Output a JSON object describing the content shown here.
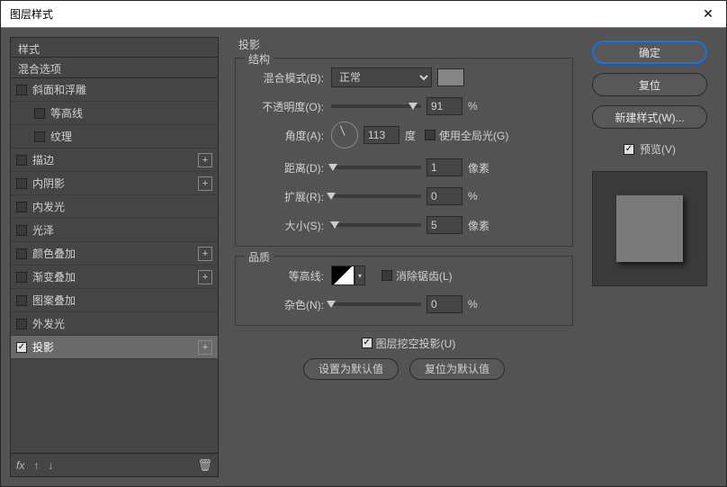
{
  "window": {
    "title": "图层样式"
  },
  "left": {
    "header": "样式",
    "blending": "混合选项",
    "items": [
      {
        "label": "斜面和浮雕",
        "checked": false,
        "plus": false
      },
      {
        "label": "等高线",
        "checked": false,
        "indent": true
      },
      {
        "label": "纹理",
        "checked": false,
        "indent": true
      },
      {
        "label": "描边",
        "checked": false,
        "plus": true
      },
      {
        "label": "内阴影",
        "checked": false,
        "plus": true
      },
      {
        "label": "内发光",
        "checked": false
      },
      {
        "label": "光泽",
        "checked": false
      },
      {
        "label": "颜色叠加",
        "checked": false,
        "plus": true
      },
      {
        "label": "渐变叠加",
        "checked": false,
        "plus": true
      },
      {
        "label": "图案叠加",
        "checked": false
      },
      {
        "label": "外发光",
        "checked": false
      },
      {
        "label": "投影",
        "checked": true,
        "plus": true,
        "selected": true
      }
    ],
    "footer_fx": "fx"
  },
  "mid": {
    "title": "投影",
    "structure": {
      "legend": "结构",
      "blend_mode_label": "混合模式(B):",
      "blend_mode_value": "正常",
      "opacity_label": "不透明度(O):",
      "opacity_value": "91",
      "opacity_unit": "%",
      "angle_label": "角度(A):",
      "angle_value": "113",
      "angle_unit": "度",
      "global_light_label": "使用全局光(G)",
      "distance_label": "距离(D):",
      "distance_value": "1",
      "distance_unit": "像素",
      "spread_label": "扩展(R):",
      "spread_value": "0",
      "spread_unit": "%",
      "size_label": "大小(S):",
      "size_value": "5",
      "size_unit": "像素"
    },
    "quality": {
      "legend": "品质",
      "contour_label": "等高线:",
      "antialias_label": "消除锯齿(L)",
      "noise_label": "杂色(N):",
      "noise_value": "0",
      "noise_unit": "%"
    },
    "knockout_label": "图层挖空投影(U)",
    "btn_default": "设置为默认值",
    "btn_reset": "复位为默认值"
  },
  "right": {
    "ok": "确定",
    "cancel": "复位",
    "new_style": "新建样式(W)...",
    "preview": "预览(V)"
  }
}
